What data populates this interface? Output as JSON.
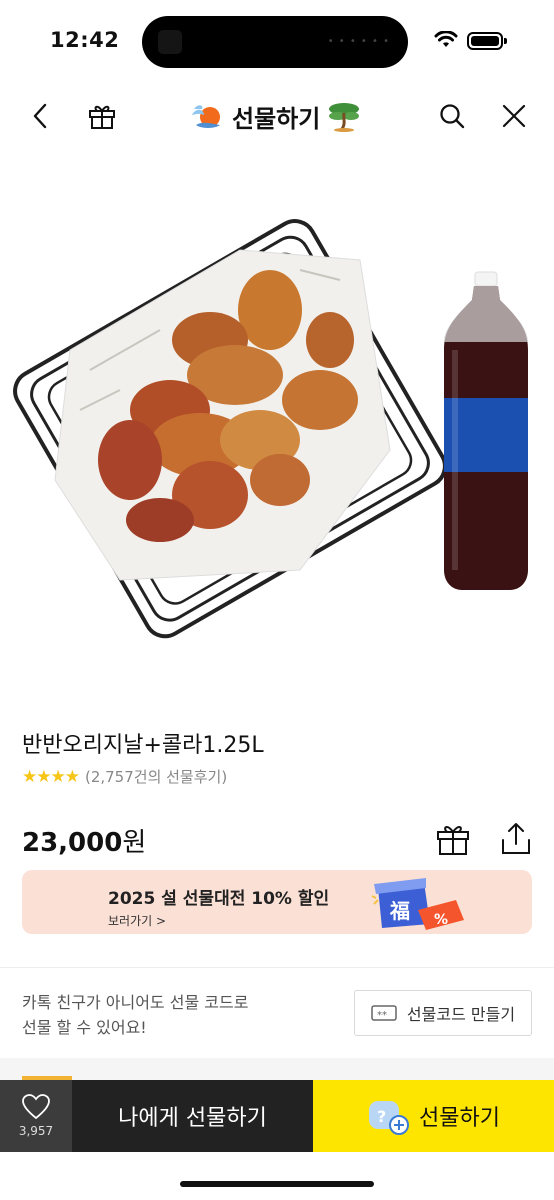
{
  "status": {
    "time": "12:42"
  },
  "nav": {
    "title": "선물하기"
  },
  "product": {
    "name": "반반오리지날+콜라1.25L",
    "stars": "★★★★",
    "review_text": "(2,757건의 선물후기)",
    "price": "23,000",
    "currency": "원"
  },
  "banner": {
    "title": "2025 설 선물대전 10% 할인",
    "subtitle": "보러가기 >",
    "badge_char": "福",
    "badge_percent": "%"
  },
  "gift_code": {
    "description_line1": "카톡 친구가 아니어도 선물 코드로",
    "description_line2": "선물 할 수 있어요!",
    "button_label": "선물코드 만들기",
    "button_icon_text": "**"
  },
  "bottom": {
    "wish_count": "3,957",
    "self_gift_label": "나에게 선물하기",
    "gift_label": "선물하기"
  },
  "colors": {
    "accent_yellow": "#fee500",
    "dark_button": "#222222",
    "banner_bg": "#fbe0d5",
    "star": "#f7c516"
  }
}
